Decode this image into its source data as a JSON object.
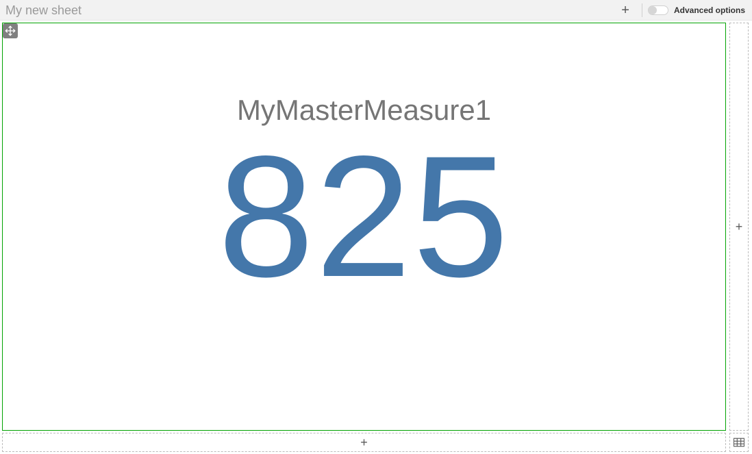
{
  "topbar": {
    "sheet_title": "My new sheet",
    "advanced_options_label": "Advanced options",
    "advanced_options_enabled": false
  },
  "kpi": {
    "measure_label": "MyMasterMeasure1",
    "value": "825",
    "value_color": "#4477aa"
  },
  "add": {
    "plus_glyph": "+"
  },
  "chart_data": {
    "type": "kpi",
    "title": "MyMasterMeasure1",
    "value": 825,
    "xlabel": "",
    "ylabel": ""
  }
}
